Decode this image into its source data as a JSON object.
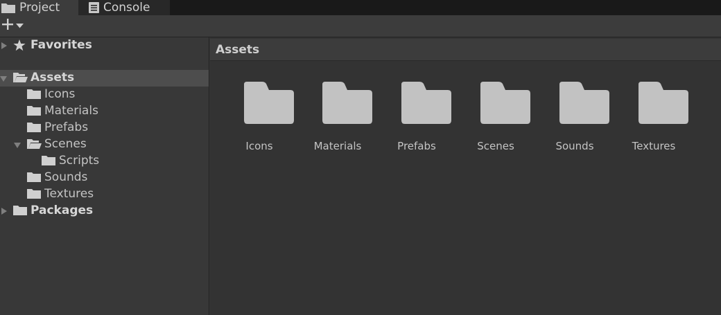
{
  "tabs": [
    {
      "label": "Project",
      "icon": "folder-icon",
      "active": true
    },
    {
      "label": "Console",
      "icon": "console-icon",
      "active": false
    }
  ],
  "toolbar": {
    "add_icon": "plus-icon",
    "dropdown_icon": "dropdown-arrow-icon"
  },
  "tree": {
    "favorites": {
      "label": "Favorites",
      "icon": "star-icon"
    },
    "assets": {
      "label": "Assets",
      "icon": "folder-open-icon"
    },
    "children": [
      {
        "label": "Icons"
      },
      {
        "label": "Materials"
      },
      {
        "label": "Prefabs"
      },
      {
        "label": "Scenes"
      },
      {
        "label": "Scripts"
      },
      {
        "label": "Sounds"
      },
      {
        "label": "Textures"
      }
    ],
    "packages": {
      "label": "Packages",
      "icon": "folder-icon"
    }
  },
  "content": {
    "breadcrumb": "Assets",
    "items": [
      {
        "label": "Icons"
      },
      {
        "label": "Materials"
      },
      {
        "label": "Prefabs"
      },
      {
        "label": "Scenes"
      },
      {
        "label": "Sounds"
      },
      {
        "label": "Textures"
      }
    ]
  },
  "colors": {
    "folder": "#c2c2c2",
    "selection": "#4d4d4d",
    "background": "#383838",
    "content_background": "#333333"
  }
}
